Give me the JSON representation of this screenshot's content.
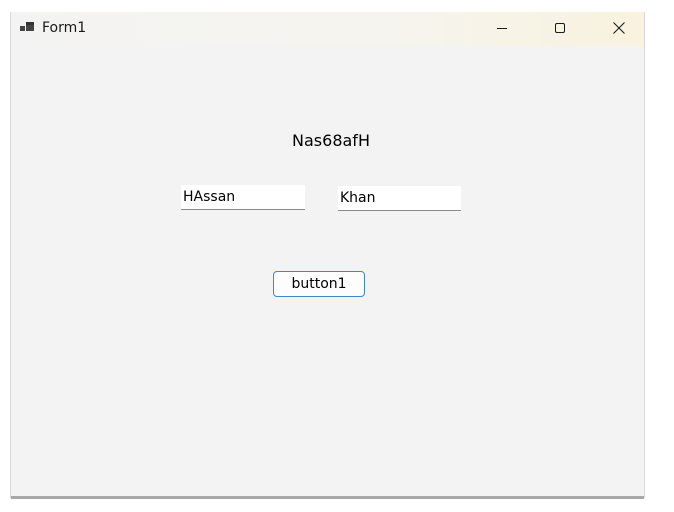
{
  "window": {
    "title": "Form1",
    "icon": "app-form-icon",
    "controls": {
      "minimize": "minimize-icon",
      "maximize": "maximize-icon",
      "close": "close-icon"
    }
  },
  "form": {
    "label_text": "Nas68afH",
    "textbox1_value": "HAssan",
    "textbox2_value": "Khan",
    "button_label": "button1"
  },
  "colors": {
    "client_background": "#f3f3f3",
    "button_border_accent": "#3f88c5"
  }
}
